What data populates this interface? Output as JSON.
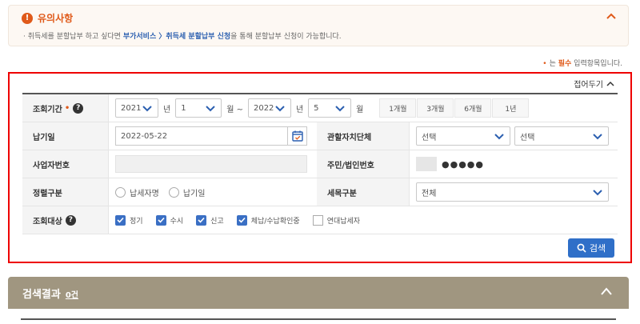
{
  "notice": {
    "title": "유의사항",
    "prefix": "· 취득세를 분할납부 하고 싶다면",
    "link": "부가서비스 〉취득세 분할납부 신청",
    "suffix": "을 통해 분할납부 신청이 가능합니다."
  },
  "required_note": {
    "dot": "•",
    "pre": "는",
    "red": "필수",
    "post": "입력항목입니다."
  },
  "form": {
    "collapse_label": "접어두기",
    "period": {
      "label": "조회기간",
      "required_mark": "•",
      "start_year": "2021",
      "start_month": "1",
      "end_year": "2022",
      "end_month": "5",
      "unit_year": "년",
      "unit_month_tilde": "월 ~",
      "unit_month": "월",
      "quick": [
        "1개월",
        "3개월",
        "6개월",
        "1년"
      ]
    },
    "due_date": {
      "label": "납기일",
      "value": "2022-05-22"
    },
    "authority": {
      "label": "관할자치단체",
      "select1": "선택",
      "select2": "선택"
    },
    "business_no": {
      "label": "사업자번호"
    },
    "resident_no": {
      "label": "주민/법인번호",
      "masked": "●●●●●"
    },
    "sort": {
      "label": "정렬구분",
      "options": [
        "납세자명",
        "납기일"
      ]
    },
    "tax_item": {
      "label": "세목구분",
      "value": "전체"
    },
    "target": {
      "label": "조회대상",
      "options": [
        {
          "label": "정기",
          "checked": true
        },
        {
          "label": "수시",
          "checked": true
        },
        {
          "label": "신고",
          "checked": true
        },
        {
          "label": "체납/수납확인중",
          "checked": true
        },
        {
          "label": "연대납세자",
          "checked": false
        }
      ]
    },
    "search_label": "검색"
  },
  "results": {
    "title": "검색결과",
    "count": "0건"
  },
  "colors": {
    "accent": "#e05a1a",
    "primary": "#2f6fc8",
    "results_bar": "#a09680",
    "highlight_border": "#e00000"
  },
  "icons": [
    "warning-icon",
    "chevron-up-icon",
    "chevron-down-icon",
    "help-icon",
    "calendar-icon",
    "search-icon",
    "check-icon"
  ]
}
